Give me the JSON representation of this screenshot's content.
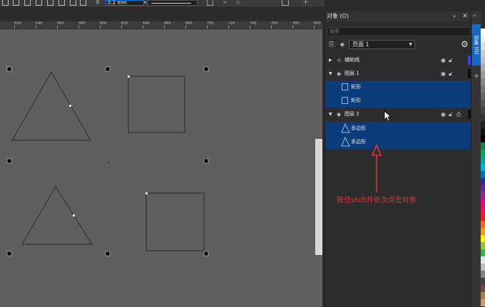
{
  "toolbar": {
    "stroke_width": "0.2 mm",
    "icons": [
      "shape-tool-icon",
      "weld-icon",
      "trim-icon",
      "intersect-icon",
      "simplify-icon",
      "front-minus-back-icon",
      "back-minus-front-icon",
      "boundary-icon",
      "stroke-icon",
      "wireframe-icon",
      "plus-icon"
    ]
  },
  "ruler": {
    "ticks": [
      "520",
      "540",
      "560",
      "580",
      "600",
      "620",
      "640",
      "660",
      "680",
      "700",
      "720",
      "740",
      "760",
      "780",
      "800"
    ]
  },
  "panel": {
    "title": "对象 (O)",
    "close": "✕",
    "search_placeholder": "搜索",
    "page_label": "页面 1",
    "rows": [
      {
        "label": "辅助线",
        "type": "layer",
        "expanded": false,
        "selected": false,
        "swatch": "#3a3aff"
      },
      {
        "label": "图层 1",
        "type": "layer",
        "expanded": true,
        "selected": false,
        "swatch": "#111111"
      },
      {
        "label": "矩形",
        "type": "rect",
        "selected": true
      },
      {
        "label": "矩形",
        "type": "rect",
        "selected": true
      },
      {
        "label": "图层 2",
        "type": "layer",
        "expanded": true,
        "selected": false,
        "swatch": "#111111"
      },
      {
        "label": "多边形",
        "type": "polygon",
        "selected": true
      },
      {
        "label": "多边形",
        "type": "polygon",
        "selected": true
      }
    ]
  },
  "docker": {
    "tab_label": "对象 (O)"
  },
  "annotation": {
    "text": "按住shift并依次点击对象"
  },
  "colors": {
    "selection": "#0d3c7c",
    "accent": "#1669c8",
    "annotation": "#e53333"
  },
  "palette": [
    "#ffffff",
    "#eeeeee",
    "#dddddd",
    "#cccccc",
    "#bbbbbb",
    "#aaaaaa",
    "#999999",
    "#888888",
    "#777777",
    "#666666",
    "#555555",
    "#444444",
    "#333333",
    "#222222",
    "#111111",
    "#000000",
    "#1a7f3a",
    "#00a651",
    "#00a0a0",
    "#00b7e0",
    "#0072bc",
    "#2e3192",
    "#662d91",
    "#92278f",
    "#ec008c",
    "#ed145b",
    "#ed1c24",
    "#f26522",
    "#f7941d",
    "#fff200",
    "#8dc63f",
    "#39b54a",
    "#e6e6e6",
    "#c0c0c0",
    "#808080",
    "#404040",
    "#6b4f3a",
    "#a67c52",
    "#c69c6d"
  ]
}
